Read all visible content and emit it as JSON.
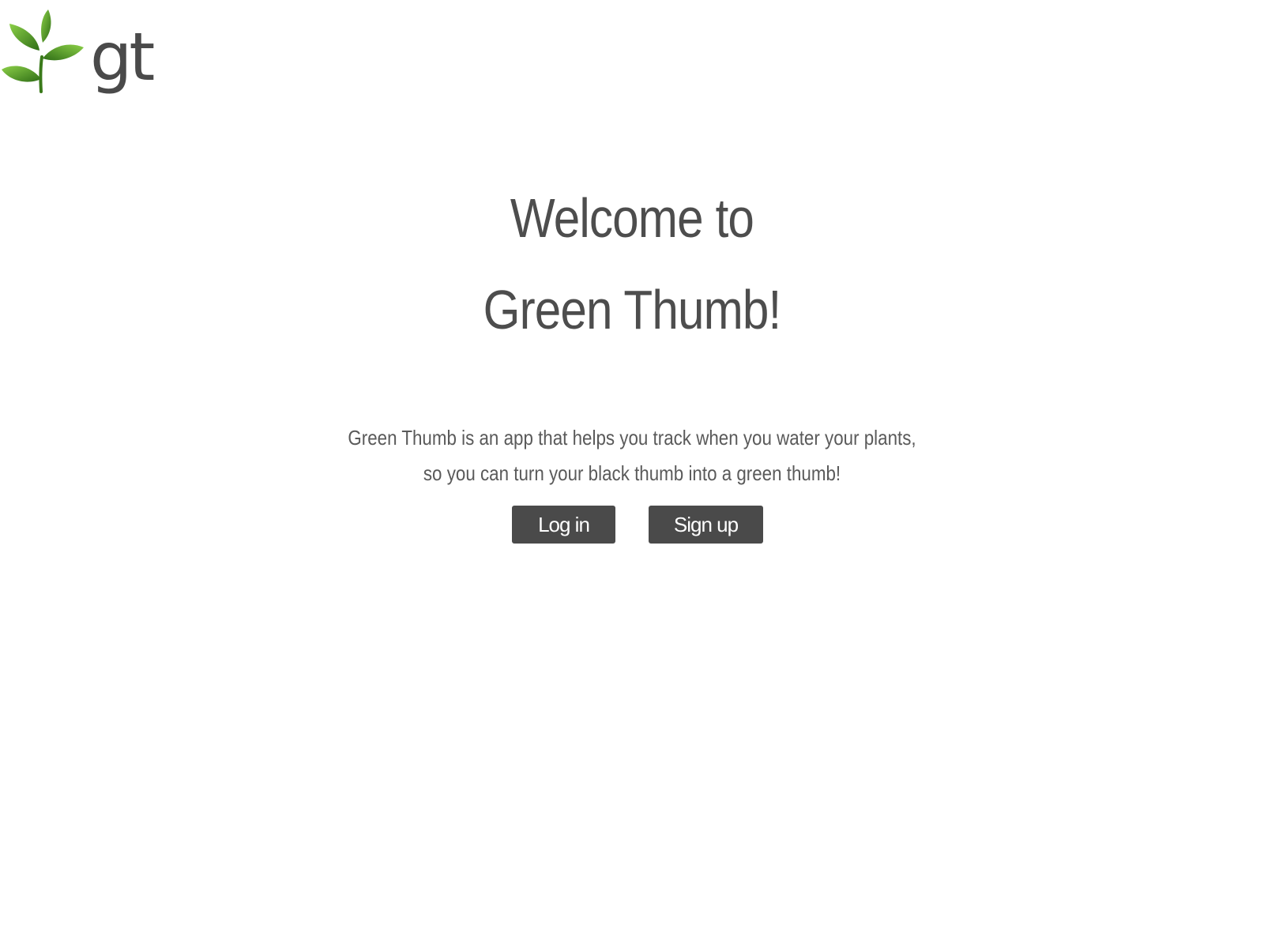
{
  "brand": {
    "logo_text": "gt",
    "colors": {
      "leaf_dark": "#3e7d1c",
      "leaf_light": "#7cc242",
      "text": "#4d4d4d",
      "button_bg": "#4a4a4a",
      "button_text": "#ffffff"
    }
  },
  "hero": {
    "title_line1": "Welcome to",
    "title_line2": "Green Thumb!",
    "description_line1": "Green Thumb is an app that helps you track when you water your plants,",
    "description_line2": "so you can turn your black thumb into a green thumb!"
  },
  "actions": {
    "login_label": "Log in",
    "signup_label": "Sign up"
  }
}
